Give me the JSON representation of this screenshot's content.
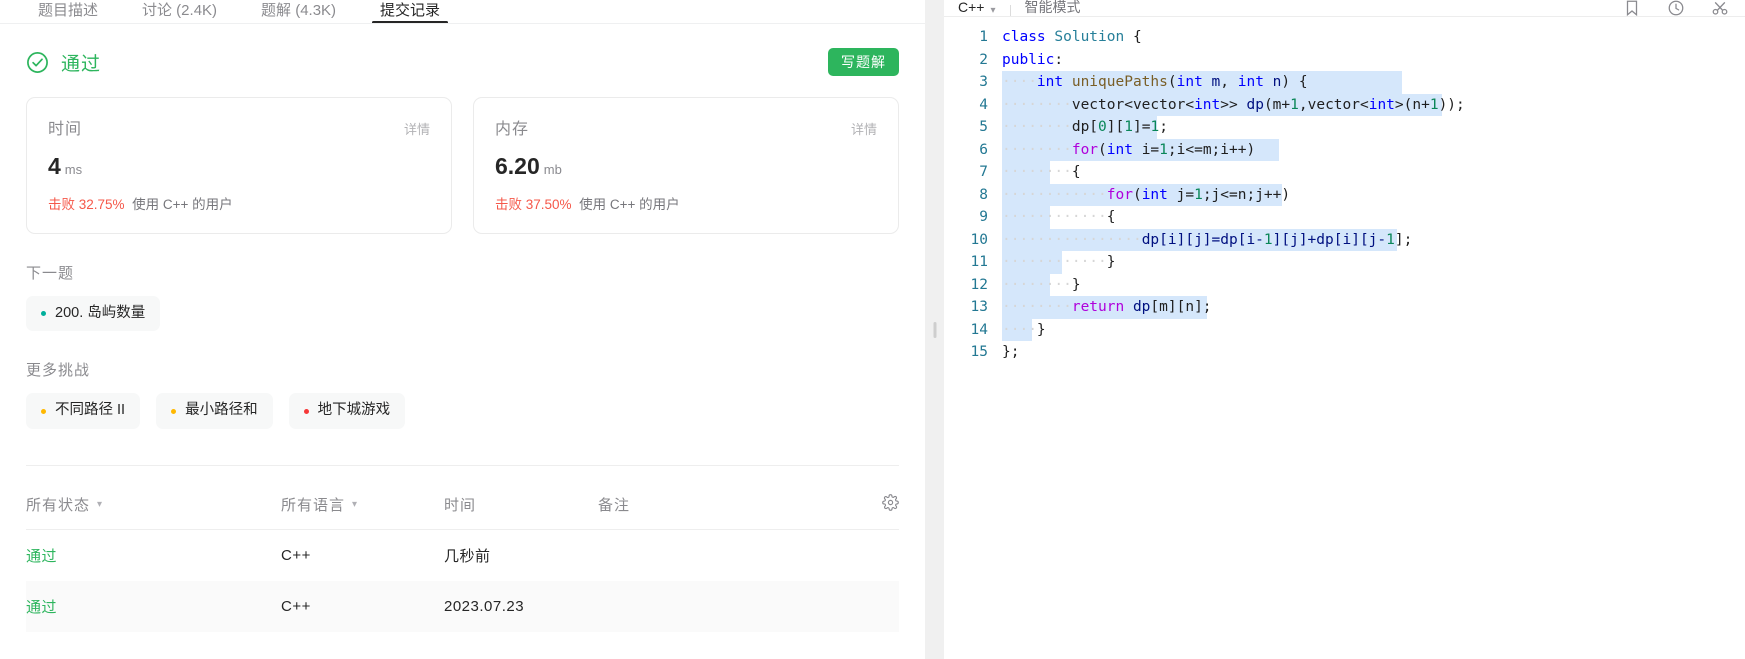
{
  "tabs": [
    {
      "label": "题目描述",
      "active": false
    },
    {
      "label": "讨论 (2.4K)",
      "active": false
    },
    {
      "label": "题解 (4.3K)",
      "active": false
    },
    {
      "label": "提交记录",
      "active": true
    }
  ],
  "result": {
    "status_text": "通过",
    "status_color": "#2db55d",
    "write_solution_label": "写题解",
    "cards": [
      {
        "title": "时间",
        "detail_label": "详情",
        "value": "4",
        "unit": "ms",
        "beat_prefix": "击败",
        "beat_percent": "32.75%",
        "beat_suffix": "使用 C++ 的用户"
      },
      {
        "title": "内存",
        "detail_label": "详情",
        "value": "6.20",
        "unit": "mb",
        "beat_prefix": "击败",
        "beat_percent": "37.50%",
        "beat_suffix": "使用 C++ 的用户"
      }
    ]
  },
  "next_problem": {
    "label": "下一题",
    "items": [
      {
        "title": "200. 岛屿数量",
        "dot_color": "#00af9b"
      }
    ]
  },
  "more_challenges": {
    "label": "更多挑战",
    "items": [
      {
        "title": "不同路径 II",
        "dot_color": "#ffb800"
      },
      {
        "title": "最小路径和",
        "dot_color": "#ffb800"
      },
      {
        "title": "地下城游戏",
        "dot_color": "#f63737"
      }
    ]
  },
  "submissions_table": {
    "headers": [
      {
        "label": "所有状态",
        "has_caret": true
      },
      {
        "label": "所有语言",
        "has_caret": true
      },
      {
        "label": "时间",
        "has_caret": false
      },
      {
        "label": "备注",
        "has_caret": false
      }
    ],
    "settings_icon": "gear-icon",
    "rows": [
      {
        "status": "通过",
        "language": "C++",
        "time": "几秒前",
        "note": ""
      },
      {
        "status": "通过",
        "language": "C++",
        "time": "2023.07.23",
        "note": ""
      }
    ]
  },
  "editor": {
    "language": "C++",
    "mode_label": "智能模式",
    "icons": [
      "bookmark-icon",
      "history-icon",
      "shuffle-icon"
    ],
    "code_lines": [
      {
        "n": "1",
        "segments": [
          {
            "t": "class ",
            "c": "tok-kw"
          },
          {
            "t": "Solution ",
            "c": "tok-type"
          },
          {
            "t": "{",
            "c": "tok-plain"
          }
        ]
      },
      {
        "n": "2",
        "segments": [
          {
            "t": "public",
            "c": "tok-kw"
          },
          {
            "t": ":",
            "c": "tok-plain"
          }
        ]
      },
      {
        "n": "3",
        "segments": [
          {
            "t": "    int ",
            "c": "tok-kw"
          },
          {
            "t": "uniquePaths",
            "c": "tok-fn"
          },
          {
            "t": "(",
            "c": "tok-plain"
          },
          {
            "t": "int ",
            "c": "tok-kw"
          },
          {
            "t": "m",
            "c": "tok-var"
          },
          {
            "t": ", ",
            "c": "tok-plain"
          },
          {
            "t": "int ",
            "c": "tok-kw"
          },
          {
            "t": "n",
            "c": "tok-var"
          },
          {
            "t": ") {",
            "c": "tok-plain"
          }
        ]
      },
      {
        "n": "4",
        "segments": [
          {
            "t": "        vector<vector<",
            "c": "tok-plain"
          },
          {
            "t": "int",
            "c": "tok-kw"
          },
          {
            "t": ">> ",
            "c": "tok-plain"
          },
          {
            "t": "dp",
            "c": "tok-var"
          },
          {
            "t": "(m+",
            "c": "tok-plain"
          },
          {
            "t": "1",
            "c": "tok-num"
          },
          {
            "t": ",vector<",
            "c": "tok-plain"
          },
          {
            "t": "int",
            "c": "tok-kw"
          },
          {
            "t": ">(n+",
            "c": "tok-plain"
          },
          {
            "t": "1",
            "c": "tok-num"
          },
          {
            "t": "));",
            "c": "tok-plain"
          }
        ]
      },
      {
        "n": "5",
        "segments": [
          {
            "t": "        dp[",
            "c": "tok-plain"
          },
          {
            "t": "0",
            "c": "tok-num"
          },
          {
            "t": "][",
            "c": "tok-plain"
          },
          {
            "t": "1",
            "c": "tok-num"
          },
          {
            "t": "]=",
            "c": "tok-plain"
          },
          {
            "t": "1",
            "c": "tok-num"
          },
          {
            "t": ";",
            "c": "tok-plain"
          }
        ]
      },
      {
        "n": "6",
        "segments": [
          {
            "t": "        for",
            "c": "tok-kw2"
          },
          {
            "t": "(",
            "c": "tok-plain"
          },
          {
            "t": "int ",
            "c": "tok-kw"
          },
          {
            "t": "i=",
            "c": "tok-plain"
          },
          {
            "t": "1",
            "c": "tok-num"
          },
          {
            "t": ";i<=m;i++)",
            "c": "tok-plain"
          }
        ]
      },
      {
        "n": "7",
        "segments": [
          {
            "t": "        {",
            "c": "tok-plain"
          }
        ]
      },
      {
        "n": "8",
        "segments": [
          {
            "t": "            for",
            "c": "tok-kw2"
          },
          {
            "t": "(",
            "c": "tok-plain"
          },
          {
            "t": "int ",
            "c": "tok-kw"
          },
          {
            "t": "j=",
            "c": "tok-plain"
          },
          {
            "t": "1",
            "c": "tok-num"
          },
          {
            "t": ";j<=n;j++)",
            "c": "tok-plain"
          }
        ]
      },
      {
        "n": "9",
        "segments": [
          {
            "t": "            {",
            "c": "tok-plain"
          }
        ]
      },
      {
        "n": "10",
        "segments": [
          {
            "t": "                dp[i][j]=dp[i-",
            "c": "tok-var"
          },
          {
            "t": "1",
            "c": "tok-num"
          },
          {
            "t": "][j]+dp[i][j-",
            "c": "tok-var"
          },
          {
            "t": "1",
            "c": "tok-num"
          },
          {
            "t": "];",
            "c": "tok-plain"
          }
        ]
      },
      {
        "n": "11",
        "segments": [
          {
            "t": "            }",
            "c": "tok-plain"
          }
        ]
      },
      {
        "n": "12",
        "segments": [
          {
            "t": "        }",
            "c": "tok-plain"
          }
        ]
      },
      {
        "n": "13",
        "segments": [
          {
            "t": "        return ",
            "c": "tok-kw2"
          },
          {
            "t": "dp",
            "c": "tok-var"
          },
          {
            "t": "[m][n];",
            "c": "tok-plain"
          }
        ]
      },
      {
        "n": "14",
        "segments": [
          {
            "t": "    }",
            "c": "tok-plain"
          }
        ]
      },
      {
        "n": "15",
        "segments": [
          {
            "t": "};",
            "c": "tok-plain"
          }
        ]
      }
    ],
    "selection_widths": [
      0,
      0,
      400,
      440,
      155,
      277,
      48,
      280,
      48,
      395,
      60,
      48,
      205,
      30,
      0
    ]
  }
}
